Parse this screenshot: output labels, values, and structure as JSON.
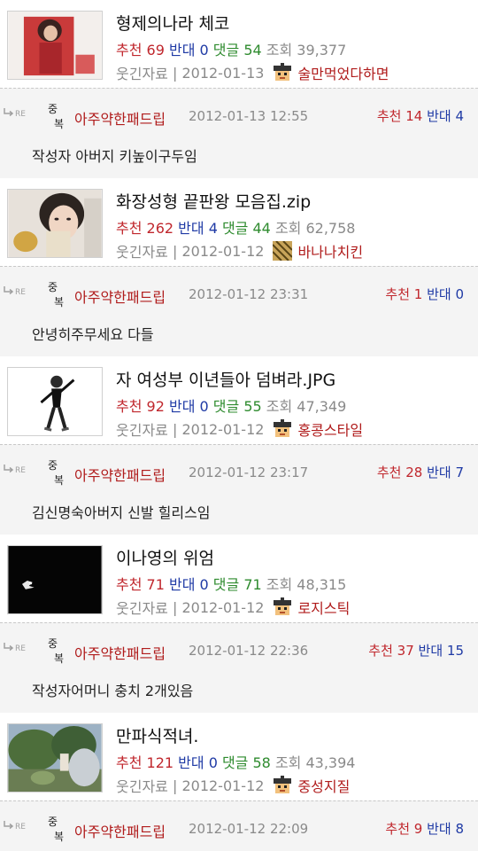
{
  "labels": {
    "recommend": "추천",
    "oppose": "반대",
    "comments": "댓글",
    "views": "조회",
    "re": "RE",
    "badge_top": "중",
    "badge_bottom": "복"
  },
  "colors": {
    "recommend": "#c0272d",
    "oppose": "#1f3aa5",
    "comments": "#2e8b2e",
    "nick": "#b01c1c",
    "comment_bg": "#f4f4f4"
  },
  "items": [
    {
      "post": {
        "title": "형제의나라 체코",
        "recommend": "69",
        "oppose": "0",
        "comments": "54",
        "views": "39,377",
        "category": "웃긴자료",
        "date": "2012-01-13",
        "author": "술만먹었다하면",
        "author_icon": "level-icon-cap",
        "thumb": "photo-thumbnail-red"
      },
      "reply": {
        "nick": "아주약한패드립",
        "datetime": "2012-01-13 12:55",
        "recommend": "14",
        "oppose": "4",
        "text": "작성자 아버지 키높이구두임"
      }
    },
    {
      "post": {
        "title": "화장성형 끝판왕 모음집.zip",
        "recommend": "262",
        "oppose": "4",
        "comments": "44",
        "views": "62,758",
        "category": "웃긴자료",
        "date": "2012-01-12",
        "author": "바나나치킨",
        "author_icon": "level-icon-striped",
        "thumb": "photo-thumbnail-face"
      },
      "reply": {
        "nick": "아주약한패드립",
        "datetime": "2012-01-12 23:31",
        "recommend": "1",
        "oppose": "0",
        "text": "안녕히주무세요 다들"
      }
    },
    {
      "post": {
        "title": "자 여성부 이년들아 덤벼라.JPG",
        "recommend": "92",
        "oppose": "0",
        "comments": "55",
        "views": "47,349",
        "category": "웃긴자료",
        "date": "2012-01-12",
        "author": "홍콩스타일",
        "author_icon": "level-icon-cap",
        "thumb": "photo-thumbnail-figure"
      },
      "reply": {
        "nick": "아주약한패드립",
        "datetime": "2012-01-12 23:17",
        "recommend": "28",
        "oppose": "7",
        "text": "김신명숙아버지 신발 힐리스임"
      }
    },
    {
      "post": {
        "title": "이나영의 위엄",
        "recommend": "71",
        "oppose": "0",
        "comments": "71",
        "views": "48,315",
        "category": "웃긴자료",
        "date": "2012-01-12",
        "author": "로지스틱",
        "author_icon": "level-icon-cap",
        "thumb": "photo-thumbnail-dark"
      },
      "reply": {
        "nick": "아주약한패드립",
        "datetime": "2012-01-12 22:36",
        "recommend": "37",
        "oppose": "15",
        "text": "작성자어머니 충치 2개있음"
      }
    },
    {
      "post": {
        "title": "만파식적녀.",
        "recommend": "121",
        "oppose": "0",
        "comments": "58",
        "views": "43,394",
        "category": "웃긴자료",
        "date": "2012-01-12",
        "author": "중성지질",
        "author_icon": "level-icon-cap",
        "thumb": "photo-thumbnail-garden"
      },
      "reply": {
        "nick": "아주약한패드립",
        "datetime": "2012-01-12 22:09",
        "recommend": "9",
        "oppose": "8",
        "text": ""
      }
    }
  ]
}
